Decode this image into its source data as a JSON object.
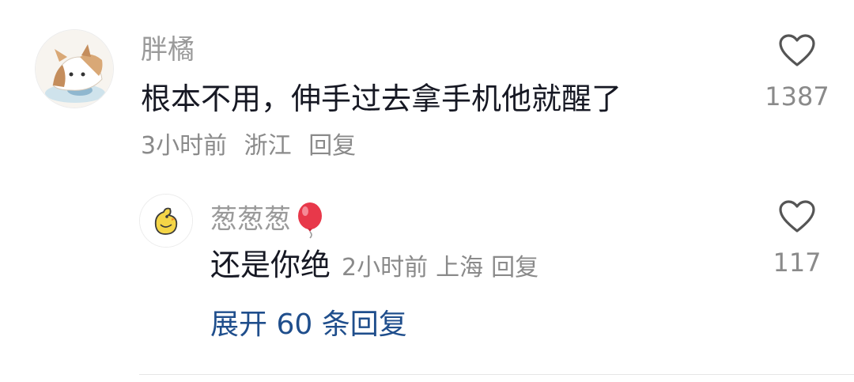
{
  "comment": {
    "username": "胖橘",
    "content": "根本不用，伸手过去拿手机他就醒了",
    "time": "3小时前",
    "location": "浙江",
    "reply_label": "回复",
    "like_count": "1387"
  },
  "reply": {
    "username": "葱葱葱",
    "content": "还是你绝",
    "time": "2小时前",
    "location": "上海",
    "reply_label": "回复",
    "like_count": "117"
  },
  "expand_replies": "展开 60 条回复",
  "icons": {
    "like": "heart-outline-icon",
    "balloon": "red-balloon-emoji"
  },
  "colors": {
    "username": "#9a9a9a",
    "content": "#161823",
    "meta": "#8a8a8a",
    "link": "#1f4e8c",
    "balloon": "#e8384a"
  }
}
